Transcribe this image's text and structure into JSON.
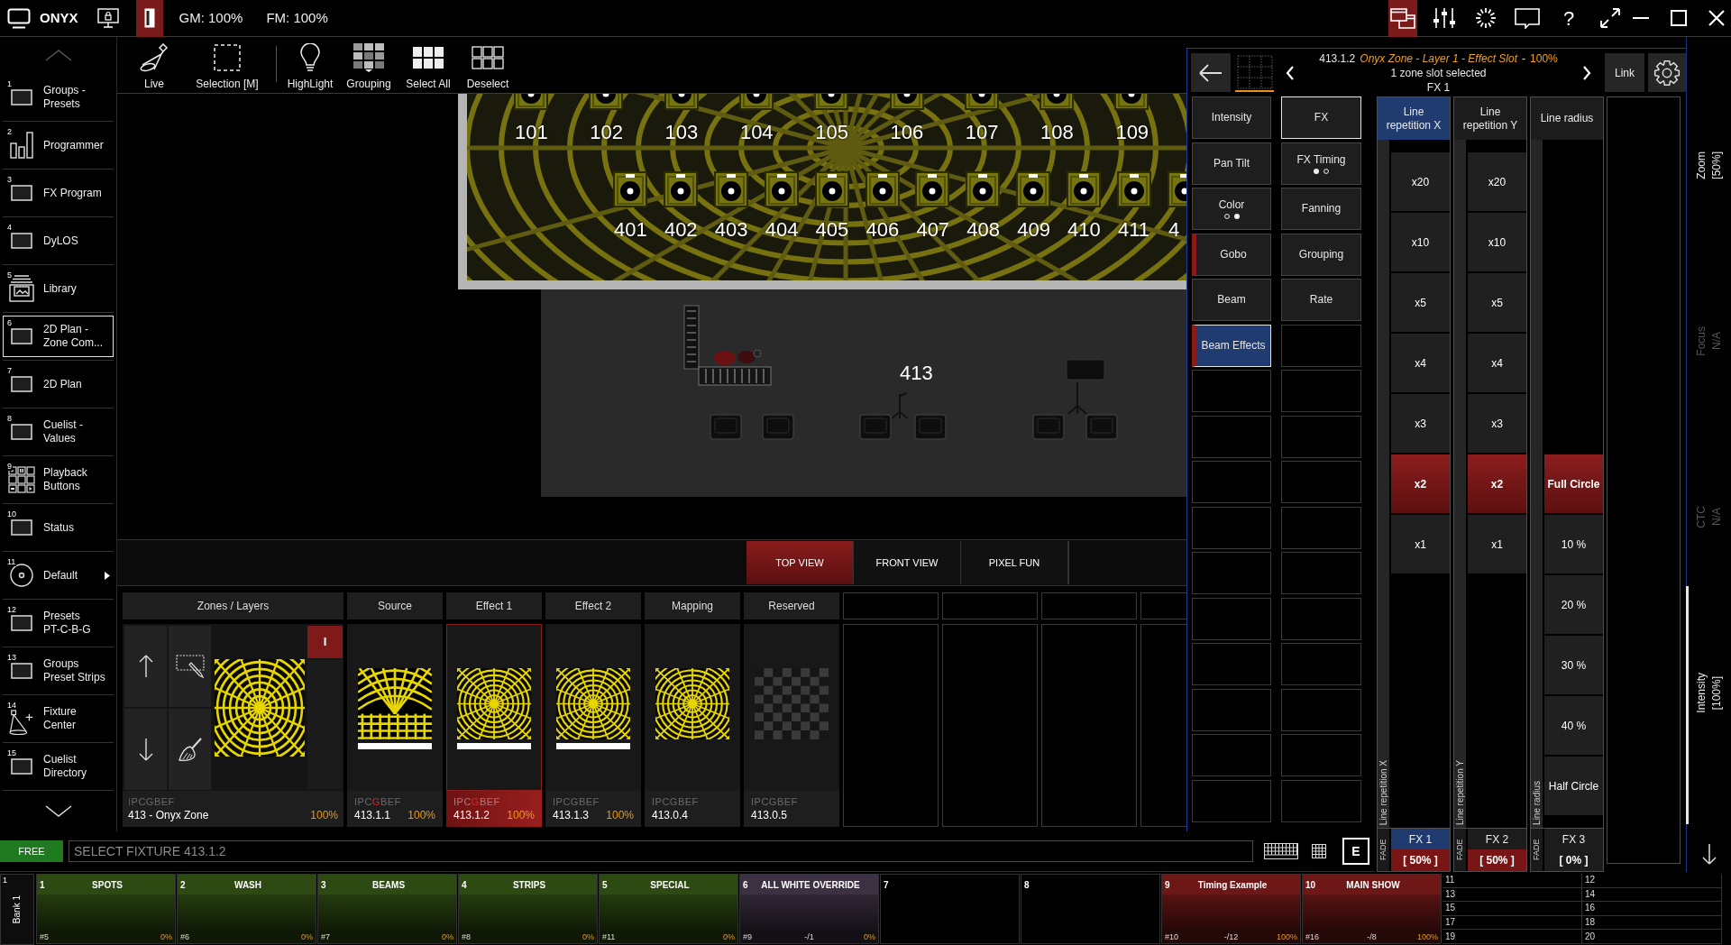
{
  "top_bar": {
    "app_name": "ONYX",
    "layout_toggle": {
      "on": true
    },
    "gm": "GM: 100%",
    "fm": "FM: 100%",
    "tools": [
      {
        "active": true
      },
      {
        "active": false
      },
      {
        "active": false
      },
      {
        "active": false
      },
      {
        "label": "?",
        "active": false
      },
      {
        "active": false
      }
    ]
  },
  "sidebar": {
    "items": [
      {
        "number": "1",
        "label": "Groups -\nPresets",
        "kind": "view",
        "selected": false,
        "submenu": false
      },
      {
        "number": "2",
        "label": "Programmer",
        "kind": "programmer",
        "selected": false,
        "submenu": false
      },
      {
        "number": "3",
        "label": "FX Program",
        "kind": "view",
        "selected": false,
        "submenu": false
      },
      {
        "number": "4",
        "label": "DyLOS",
        "kind": "view",
        "selected": false,
        "submenu": false
      },
      {
        "number": "5",
        "label": "Library",
        "kind": "library",
        "selected": false,
        "submenu": false
      },
      {
        "number": "6",
        "label": "2D Plan -\nZone Com...",
        "kind": "view",
        "selected": true,
        "submenu": false
      },
      {
        "number": "7",
        "label": "2D Plan",
        "kind": "view",
        "selected": false,
        "submenu": false
      },
      {
        "number": "8",
        "label": "Cuelist -\nValues",
        "kind": "view",
        "selected": false,
        "submenu": false
      },
      {
        "number": "9",
        "label": "Playback\nButtons",
        "kind": "buttons",
        "selected": false,
        "submenu": false
      },
      {
        "number": "10",
        "label": "Status",
        "kind": "view",
        "selected": false,
        "submenu": false
      },
      {
        "number": "11",
        "label": "Default",
        "kind": "layout",
        "selected": false,
        "submenu": true
      },
      {
        "number": "12",
        "label": "Presets\nPT-C-B-G",
        "kind": "view",
        "selected": false,
        "submenu": false
      },
      {
        "number": "13",
        "label": "Groups\nPreset Strips",
        "kind": "view",
        "selected": false,
        "submenu": false
      },
      {
        "number": "14",
        "label": "Fixture\nCenter",
        "kind": "fixtures",
        "selected": false,
        "submenu": false
      },
      {
        "number": "15",
        "label": "Cuelist\nDirectory",
        "kind": "view",
        "selected": false,
        "submenu": false
      }
    ]
  },
  "toolbar": {
    "items": [
      {
        "label": "Live"
      },
      {
        "label": "Selection [M]"
      },
      {
        "label": "HighLight"
      },
      {
        "label": "Grouping"
      },
      {
        "label": "Select All"
      },
      {
        "label": "Deselect"
      }
    ]
  },
  "plan": {
    "top_row": [
      "101",
      "102",
      "103",
      "104",
      "105",
      "106",
      "107",
      "108",
      "109"
    ],
    "front_row": [
      "401",
      "402",
      "403",
      "404",
      "405",
      "406",
      "407",
      "408",
      "409",
      "410",
      "411",
      "4"
    ],
    "zone_label": "413"
  },
  "view_tabs": [
    {
      "label": "TOP VIEW",
      "selected": true
    },
    {
      "label": "FRONT VIEW",
      "selected": false
    },
    {
      "label": "PIXEL FUN",
      "selected": false
    }
  ],
  "zones": {
    "header": "Zones / Layers",
    "layer_button": {
      "label": "I",
      "on": true
    },
    "zone": {
      "kind": "web",
      "attributes": [
        {
          "letter": "I",
          "active": true
        },
        {
          "letter": "P",
          "active": false
        },
        {
          "letter": "C",
          "active": false
        },
        {
          "letter": "G",
          "active": false
        },
        {
          "letter": "B",
          "active": false
        },
        {
          "letter": "E",
          "active": false
        },
        {
          "letter": "F",
          "active": false
        }
      ],
      "name": "413 - Onyx Zone",
      "intensity": "100%"
    },
    "slots": [
      {
        "header": "Source",
        "kind": "grid",
        "bar": true,
        "selected": false,
        "attributes": [
          {
            "letter": "I",
            "active": false
          },
          {
            "letter": "P",
            "active": false
          },
          {
            "letter": "C",
            "active": false
          },
          {
            "letter": "G",
            "active": true
          },
          {
            "letter": "B",
            "active": false
          },
          {
            "letter": "E",
            "active": false
          },
          {
            "letter": "F",
            "active": false
          }
        ],
        "id": "413.1.1",
        "intensity": "100%"
      },
      {
        "header": "Effect 1",
        "kind": "web",
        "bar": true,
        "selected": true,
        "attributes": [
          {
            "letter": "I",
            "active": false
          },
          {
            "letter": "P",
            "active": false
          },
          {
            "letter": "C",
            "active": false
          },
          {
            "letter": "G",
            "active": true
          },
          {
            "letter": "B",
            "active": false
          },
          {
            "letter": "E",
            "active": false
          },
          {
            "letter": "F",
            "active": false
          }
        ],
        "id": "413.1.2",
        "intensity": "100%"
      },
      {
        "header": "Effect 2",
        "kind": "web",
        "bar": true,
        "selected": false,
        "attributes": [
          {
            "letter": "I",
            "active": false
          },
          {
            "letter": "P",
            "active": false
          },
          {
            "letter": "C",
            "active": false
          },
          {
            "letter": "G",
            "active": false
          },
          {
            "letter": "B",
            "active": false
          },
          {
            "letter": "E",
            "active": false
          },
          {
            "letter": "F",
            "active": false
          }
        ],
        "id": "413.1.3",
        "intensity": "100%"
      },
      {
        "header": "Mapping",
        "kind": "web",
        "bar": false,
        "selected": false,
        "attributes": [
          {
            "letter": "I",
            "active": false
          },
          {
            "letter": "P",
            "active": false
          },
          {
            "letter": "C",
            "active": false
          },
          {
            "letter": "G",
            "active": false
          },
          {
            "letter": "B",
            "active": false
          },
          {
            "letter": "E",
            "active": false
          },
          {
            "letter": "F",
            "active": false
          }
        ],
        "id": "413.0.4"
      },
      {
        "header": "Reserved",
        "kind": "checker",
        "bar": false,
        "selected": false,
        "attributes": [
          {
            "letter": "I",
            "active": false
          },
          {
            "letter": "P",
            "active": false
          },
          {
            "letter": "C",
            "active": false
          },
          {
            "letter": "G",
            "active": false
          },
          {
            "letter": "B",
            "active": false
          },
          {
            "letter": "E",
            "active": false
          },
          {
            "letter": "F",
            "active": false
          }
        ],
        "id": "413.0.5"
      }
    ]
  },
  "command_line": {
    "mode": "FREE",
    "value": "SELECT FIXTURE 413.1.2",
    "edit_button": "E"
  },
  "zone_panel": {
    "header": {
      "fixture": "413.1.2",
      "zone": "Onyx Zone - Layer 1 - Effect Slot",
      "separator": "-",
      "intensity": "100%",
      "selection": "1 zone slot selected",
      "slot": "FX 1"
    },
    "link_button": "Link",
    "attribute_columns": [
      {
        "buttons": [
          {
            "label": "Intensity",
            "selected": false,
            "current": false,
            "active": false
          },
          {
            "label": "Pan Tilt",
            "selected": false,
            "current": false,
            "active": false
          },
          {
            "label": "Color",
            "selected": false,
            "current": false,
            "active": false,
            "pages": [
              {
                "current": false
              },
              {
                "current": true
              }
            ]
          },
          {
            "label": "Gobo",
            "selected": false,
            "current": false,
            "active": true
          },
          {
            "label": "Beam",
            "selected": false,
            "current": false,
            "active": false
          },
          {
            "label": "Beam Effects",
            "selected": true,
            "current": true,
            "active": true
          }
        ]
      },
      {
        "buttons": [
          {
            "label": "FX",
            "selected": true,
            "current": false,
            "active": false
          },
          {
            "label": "FX Timing",
            "selected": false,
            "current": false,
            "active": false,
            "pages": [
              {
                "current": true
              },
              {
                "current": false
              }
            ]
          },
          {
            "label": "Fanning",
            "selected": false,
            "current": false,
            "active": false
          },
          {
            "label": "Grouping",
            "selected": false,
            "current": false,
            "active": false
          },
          {
            "label": "Rate",
            "selected": false,
            "current": false,
            "active": false
          }
        ]
      }
    ],
    "parameters": [
      {
        "title": "Line repetition X",
        "selected": true,
        "side_label": "Line repetition X",
        "values": [
          {
            "label": "x20",
            "selected": false
          },
          {
            "label": "x10",
            "selected": false
          },
          {
            "label": "x5",
            "selected": false
          },
          {
            "label": "x4",
            "selected": false
          },
          {
            "label": "x3",
            "selected": false
          },
          {
            "label": "x2",
            "selected": true
          },
          {
            "label": "x1",
            "selected": false
          }
        ],
        "fade": "FADE",
        "slot": "FX 1",
        "readout": "[ 50% ]",
        "active": true
      },
      {
        "title": "Line repetition Y",
        "selected": false,
        "side_label": "Line repetition Y",
        "values": [
          {
            "label": "x20",
            "selected": false
          },
          {
            "label": "x10",
            "selected": false
          },
          {
            "label": "x5",
            "selected": false
          },
          {
            "label": "x4",
            "selected": false
          },
          {
            "label": "x3",
            "selected": false
          },
          {
            "label": "x2",
            "selected": true
          },
          {
            "label": "x1",
            "selected": false
          }
        ],
        "fade": "FADE",
        "slot": "FX 2",
        "readout": "[ 50% ]",
        "active": true
      },
      {
        "title": "Line radius",
        "selected": false,
        "side_label": "Line radius",
        "values": [
          {
            "label": "Full Circle",
            "selected": true
          },
          {
            "label": "10 %",
            "selected": false
          },
          {
            "label": "20 %",
            "selected": false
          },
          {
            "label": "30 %",
            "selected": false
          },
          {
            "label": "40 %",
            "selected": false
          },
          {
            "label": "Half Circle",
            "selected": false
          }
        ],
        "fade": "FADE",
        "slot": "FX 3",
        "readout": "[ 0% ]",
        "active": false
      }
    ]
  },
  "side_strip": [
    {
      "name": "Zoom",
      "value": "[50%]",
      "enabled": true
    },
    {
      "name": "Focus",
      "value": "N/A",
      "enabled": false
    },
    {
      "name": "CTC",
      "value": "N/A",
      "enabled": false
    },
    {
      "name": "Intensity",
      "value": "[100%]",
      "enabled": true
    }
  ],
  "playback_bar": {
    "bank": {
      "number": "1",
      "label": "Bank 1"
    },
    "playbacks": [
      {
        "number": "1",
        "title": "SPOTS",
        "color": "#2d4a12",
        "cue": "#5",
        "intensity": "0%"
      },
      {
        "number": "2",
        "title": "WASH",
        "color": "#2d4a12",
        "cue": "#6",
        "intensity": "0%"
      },
      {
        "number": "3",
        "title": "BEAMS",
        "color": "#2d4a12",
        "cue": "#7",
        "intensity": "0%"
      },
      {
        "number": "4",
        "title": "STRIPS",
        "color": "#2d4a12",
        "cue": "#8",
        "intensity": "0%"
      },
      {
        "number": "5",
        "title": "SPECIAL",
        "color": "#2d4a12",
        "cue": "#11",
        "intensity": "0%"
      },
      {
        "number": "6",
        "title": "ALL WHITE OVERRIDE",
        "color": "#3c3043",
        "cue": "#9",
        "position": "-/1",
        "intensity": "0%"
      },
      {
        "number": "7"
      },
      {
        "number": "8"
      },
      {
        "number": "9",
        "title": "Timing Example",
        "color": "#6e1717",
        "cue": "#10",
        "position": "-/12",
        "intensity": "100%"
      },
      {
        "number": "10",
        "title": "MAIN SHOW",
        "color": "#6e1717",
        "cue": "#16",
        "position": "-/8",
        "intensity": "100%"
      }
    ],
    "small_playbacks": [
      "11",
      "12",
      "13",
      "14",
      "15",
      "16",
      "17",
      "18",
      "19",
      "20"
    ]
  }
}
